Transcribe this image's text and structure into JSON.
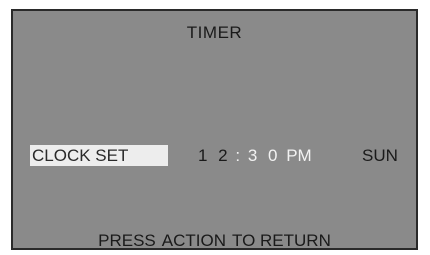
{
  "screen": {
    "title": "TIMER",
    "menu_item": "CLOCK SET",
    "time": {
      "hour": "1 2",
      "separator": ":",
      "minute": "3 0",
      "period": "PM"
    },
    "day": "SUN",
    "footer": {
      "word1": "PRESS",
      "word2": "ACTION",
      "word3": "TO RETURN"
    }
  },
  "colors": {
    "background": "#8a8a8a",
    "highlight": "#ededed",
    "active_text": "#f2f2f2",
    "text": "#1a1a1a"
  }
}
